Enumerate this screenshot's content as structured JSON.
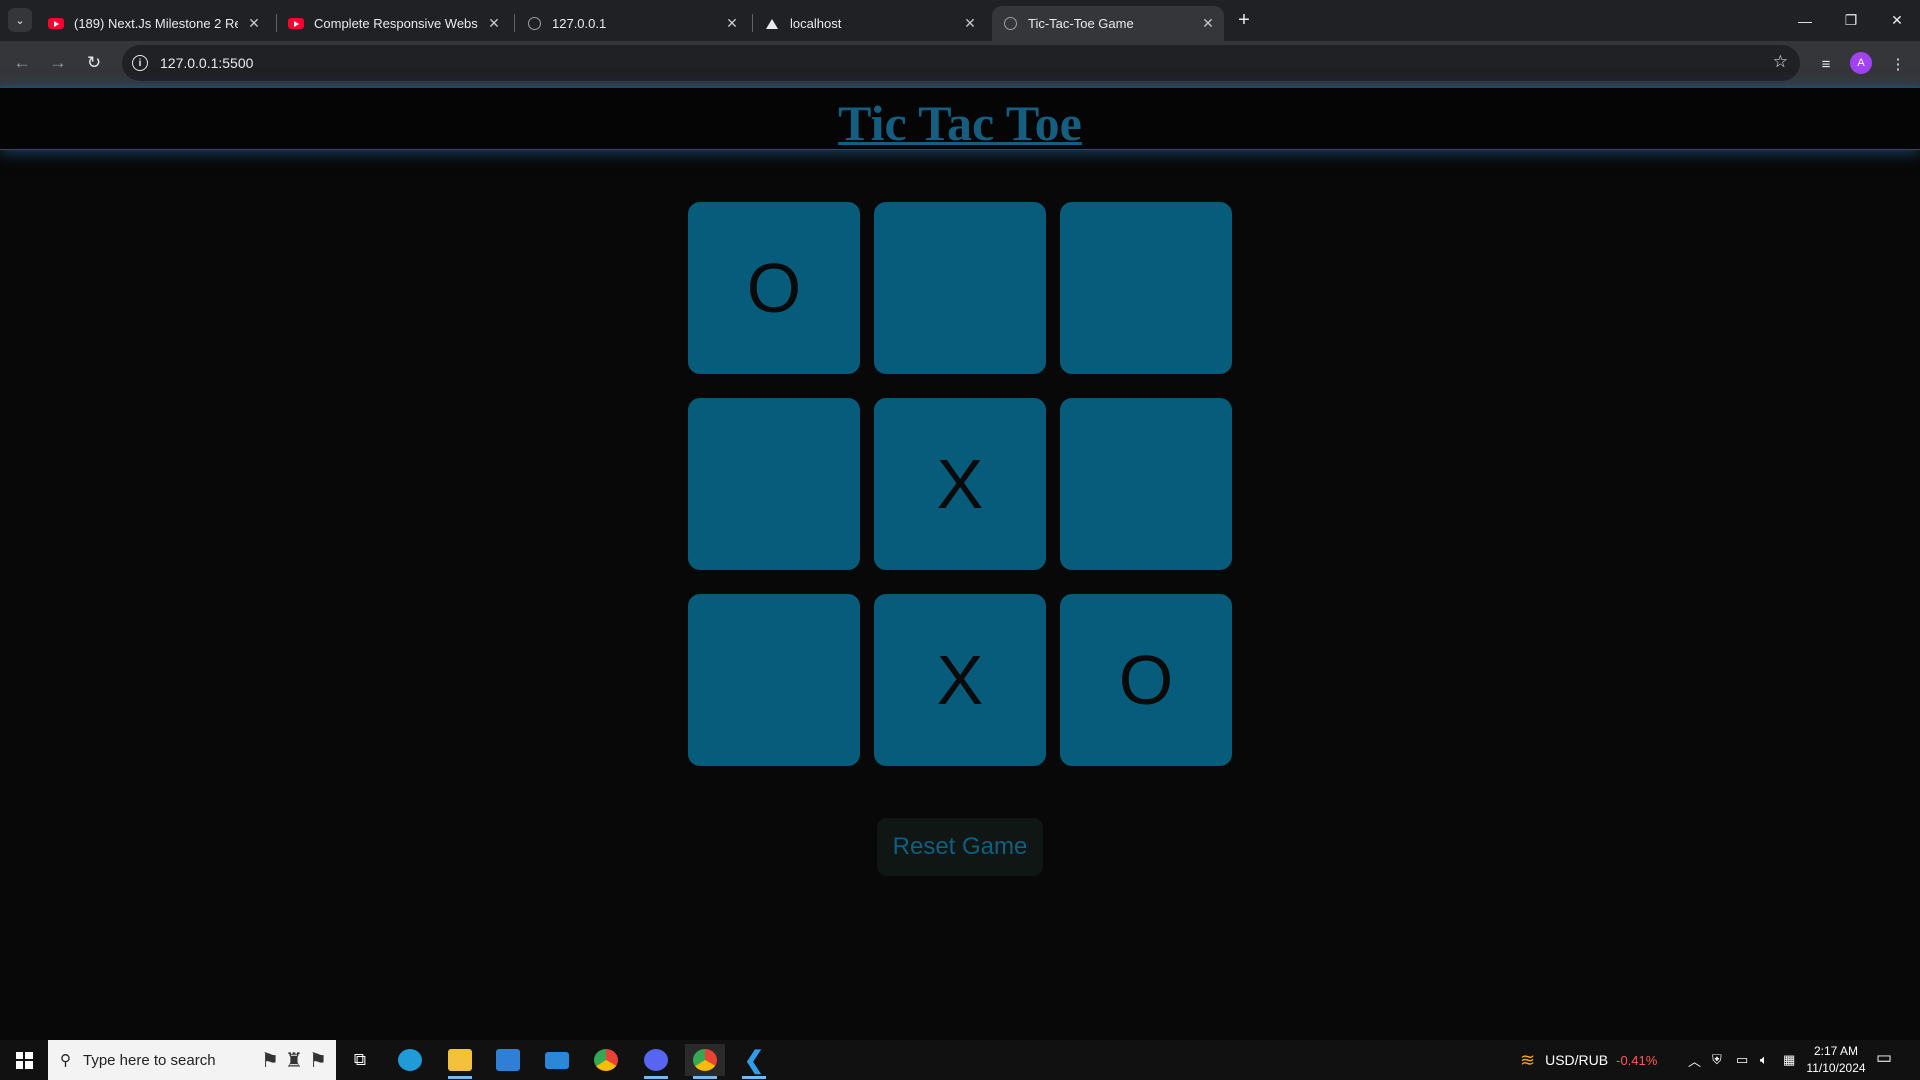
{
  "browser": {
    "tabs": [
      {
        "title": "(189) Next.Js Milestone 2 Respo",
        "favicon": "youtube-icon",
        "active": false
      },
      {
        "title": "Complete Responsive Website |",
        "favicon": "youtube-icon",
        "active": false
      },
      {
        "title": "127.0.0.1",
        "favicon": "globe-icon",
        "active": false
      },
      {
        "title": "localhost",
        "favicon": "triangle-icon",
        "active": false
      },
      {
        "title": "Tic-Tac-Toe Game",
        "favicon": "globe-icon",
        "active": true
      }
    ],
    "url": "127.0.0.1:5500",
    "profile_initial": "A"
  },
  "game": {
    "title": "Tic Tac Toe",
    "cells": [
      "O",
      "",
      "",
      "",
      "X",
      "",
      "",
      "X",
      "O"
    ],
    "reset_label": "Reset Game",
    "colors": {
      "cell": "#065c7a",
      "title": "#155e80",
      "background": "#080808"
    }
  },
  "taskbar": {
    "search_placeholder": "Type here to search",
    "ticker_symbol": "USD/RUB",
    "ticker_change": "-0.41%",
    "time": "2:17 AM",
    "date": "11/10/2024"
  }
}
